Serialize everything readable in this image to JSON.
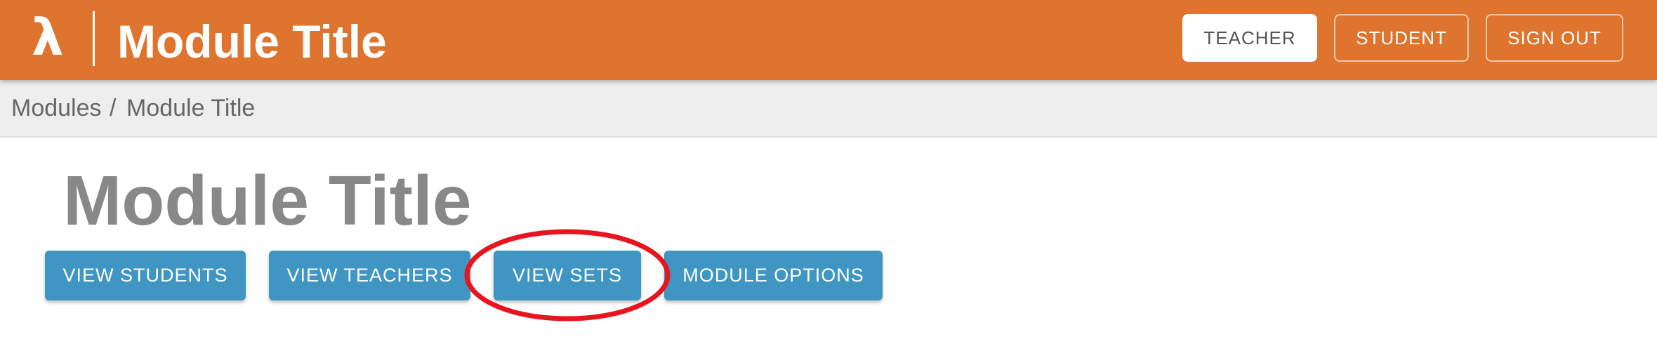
{
  "topbar": {
    "logo_glyph": "λ",
    "title": "Module Title",
    "nav": [
      {
        "label": "TEACHER",
        "active": true
      },
      {
        "label": "STUDENT",
        "active": false
      },
      {
        "label": "SIGN OUT",
        "active": false
      }
    ],
    "color": "#de742d"
  },
  "breadcrumb": {
    "root": "Modules",
    "separator": "/",
    "current": "Module Title"
  },
  "main": {
    "heading": "Module Title",
    "actions": [
      {
        "label": "VIEW STUDENTS"
      },
      {
        "label": "VIEW TEACHERS"
      },
      {
        "label": "VIEW SETS",
        "highlighted": true
      },
      {
        "label": "MODULE OPTIONS"
      }
    ],
    "button_color": "#4096c2",
    "highlight_color": "#e8141e"
  }
}
